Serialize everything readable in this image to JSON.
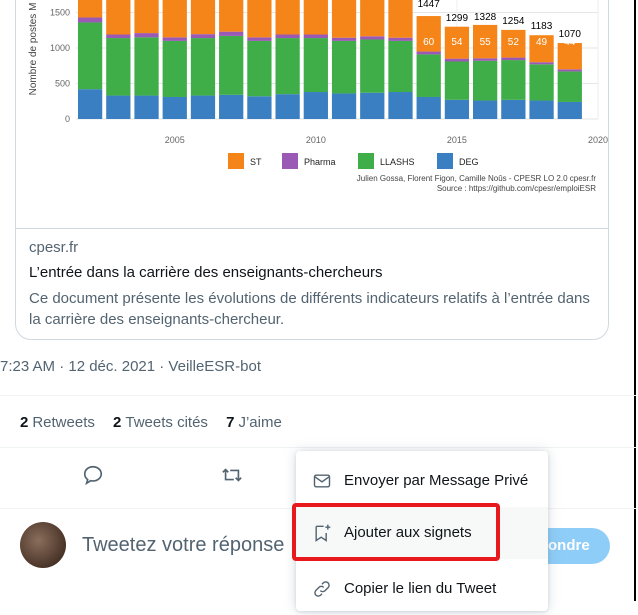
{
  "chart_data": {
    "type": "bar",
    "stacked": true,
    "ylabel": "Nombre de postes M",
    "yticks": [
      0,
      500,
      1000,
      1500
    ],
    "xticks": [
      2005,
      2010,
      2015,
      2020
    ],
    "x": [
      2002,
      2003,
      2004,
      2005,
      2006,
      2007,
      2008,
      2009,
      2010,
      2011,
      2012,
      2013,
      2014,
      2015,
      2016,
      2017,
      2018,
      2019
    ],
    "series": [
      {
        "name": "DEG",
        "color": "#3a7fc1",
        "values": [
          420,
          330,
          330,
          310,
          330,
          340,
          320,
          350,
          380,
          360,
          370,
          380,
          310,
          270,
          260,
          270,
          260,
          240
        ]
      },
      {
        "name": "LLASHS",
        "color": "#3fae49",
        "values": [
          940,
          810,
          820,
          790,
          810,
          830,
          780,
          790,
          760,
          740,
          750,
          720,
          600,
          540,
          560,
          560,
          510,
          430
        ]
      },
      {
        "name": "Pharma",
        "color": "#9b59b6",
        "values": [
          70,
          50,
          60,
          50,
          55,
          60,
          50,
          50,
          50,
          45,
          45,
          45,
          40,
          40,
          35,
          35,
          30,
          30
        ]
      },
      {
        "name": "ST",
        "color": "#f58518",
        "values": [
          900,
          720,
          760,
          700,
          740,
          770,
          720,
          760,
          720,
          700,
          690,
          680,
          500,
          450,
          470,
          390,
          380,
          370
        ]
      }
    ],
    "data_labels": [
      {
        "x": 2014,
        "value": "60"
      },
      {
        "x": 2015,
        "value": "54"
      },
      {
        "x": 2016,
        "value": "55"
      },
      {
        "x": 2017,
        "value": "52"
      },
      {
        "x": 2018,
        "value": "49"
      },
      {
        "x": 2019,
        "value": "44"
      }
    ],
    "top_labels": [
      {
        "x": 2014,
        "value": "1447"
      },
      {
        "x": 2015,
        "value": "1299"
      },
      {
        "x": 2016,
        "value": "1328"
      },
      {
        "x": 2017,
        "value": "1254"
      },
      {
        "x": 2018,
        "value": "1183"
      },
      {
        "x": 2019,
        "value": "1070"
      }
    ],
    "legend": [
      "ST",
      "Pharma",
      "LLASHS",
      "DEG"
    ],
    "legend_position": "bottom",
    "credit_line1": "Julien Gossa, Florent Figon, Camille Noûs - CPESR LO 2.0 cpesr.fr",
    "credit_line2": "Source : https://github.com/cpesr/emploiESR"
  },
  "card": {
    "domain": "cpesr.fr",
    "title": "L’entrée dans la carrière des enseignants-chercheurs",
    "description": "Ce document présente les évolutions de différents indicateurs relatifs à l’entrée dans la carrière des enseignants-chercheur."
  },
  "tweet": {
    "timestamp": "7:23 AM · 12 déc. 2021 · VeilleESR-bot",
    "stats": {
      "retweets_count": "2",
      "retweets_label": "Retweets",
      "quotes_count": "2",
      "quotes_label": "Tweets cités",
      "likes_count": "7",
      "likes_label": "J’aime"
    }
  },
  "reply": {
    "placeholder": "Tweetez votre réponse",
    "button": "ondre"
  },
  "menu": {
    "items": [
      {
        "label": "Envoyer par Message Privé",
        "icon": "envelope-icon"
      },
      {
        "label": "Ajouter aux signets",
        "icon": "bookmark-add-icon"
      },
      {
        "label": "Copier le lien du Tweet",
        "icon": "link-icon"
      }
    ]
  },
  "colors": {
    "highlight": "#e8191c",
    "accent": "#1d9bf0"
  }
}
